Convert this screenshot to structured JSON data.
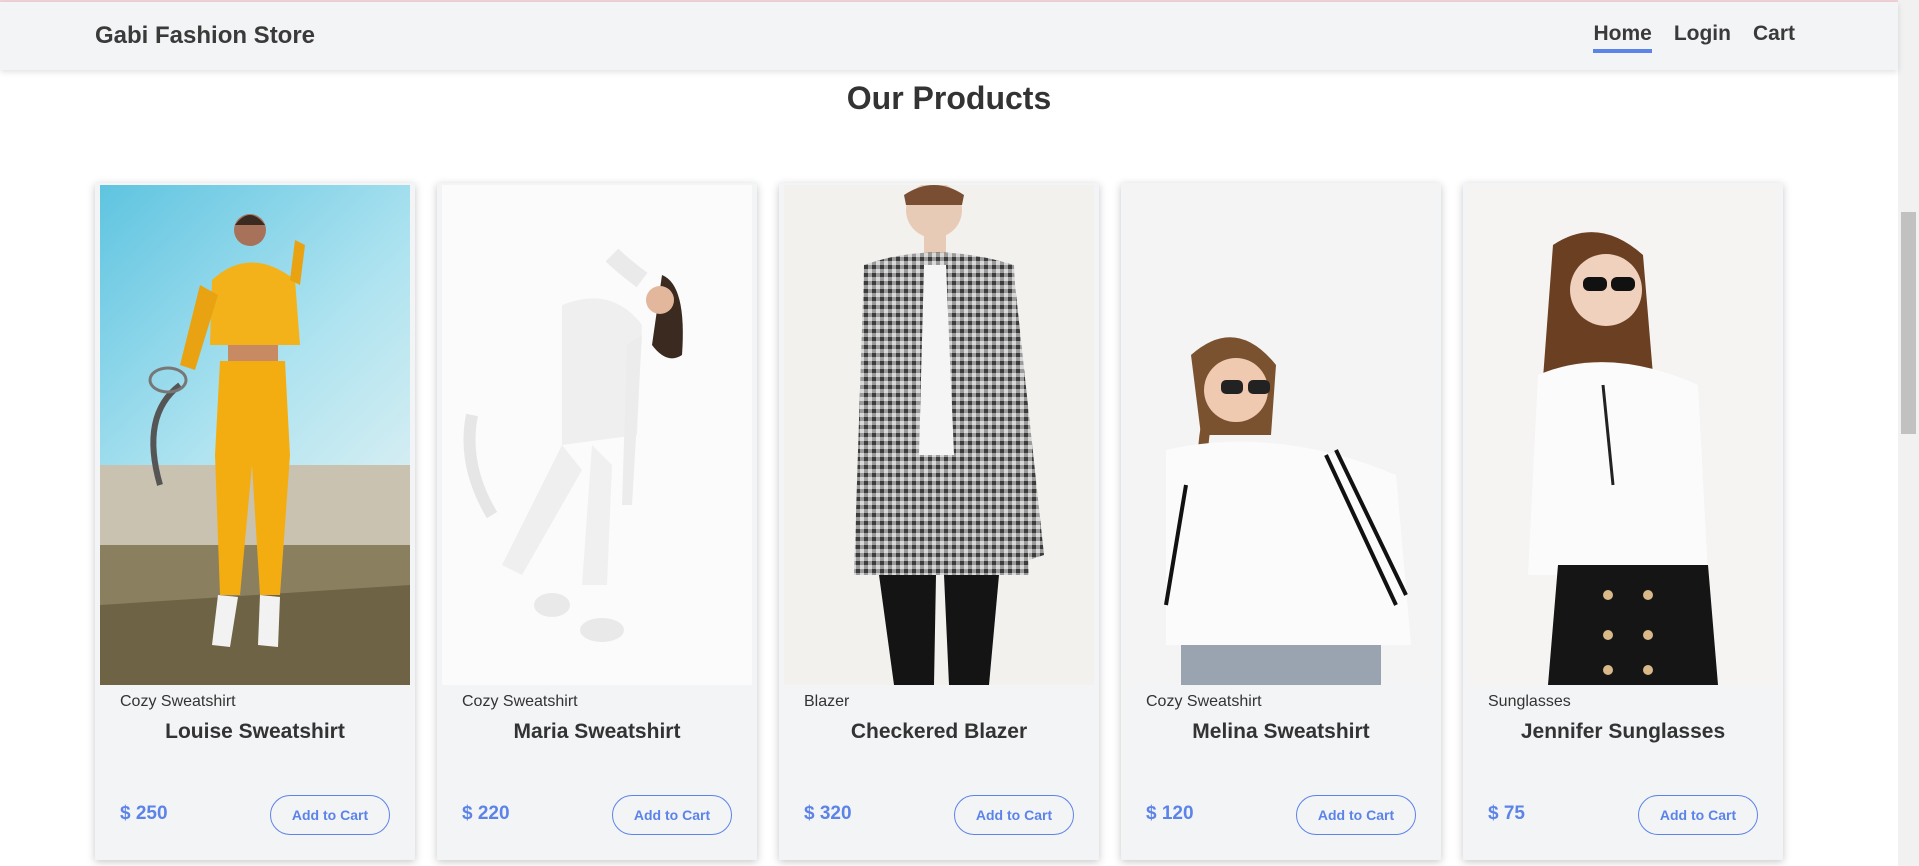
{
  "nav": {
    "brand": "Gabi Fashion Store",
    "links": [
      {
        "label": "Home",
        "active": true
      },
      {
        "label": "Login",
        "active": false
      },
      {
        "label": "Cart",
        "active": false
      }
    ]
  },
  "page_title": "Our Products",
  "accent_color": "#5b83e8",
  "products": [
    {
      "category": "Cozy Sweatshirt",
      "name": "Louise Sweatshirt",
      "price": "$ 250",
      "button": "Add to Cart"
    },
    {
      "category": "Cozy Sweatshirt",
      "name": "Maria Sweatshirt",
      "price": "$ 220",
      "button": "Add to Cart"
    },
    {
      "category": "Blazer",
      "name": "Checkered Blazer",
      "price": "$ 320",
      "button": "Add to Cart"
    },
    {
      "category": "Cozy Sweatshirt",
      "name": "Melina Sweatshirt",
      "price": "$ 120",
      "button": "Add to Cart"
    },
    {
      "category": "Sunglasses",
      "name": "Jennifer Sunglasses",
      "price": "$ 75",
      "button": "Add to Cart"
    }
  ]
}
